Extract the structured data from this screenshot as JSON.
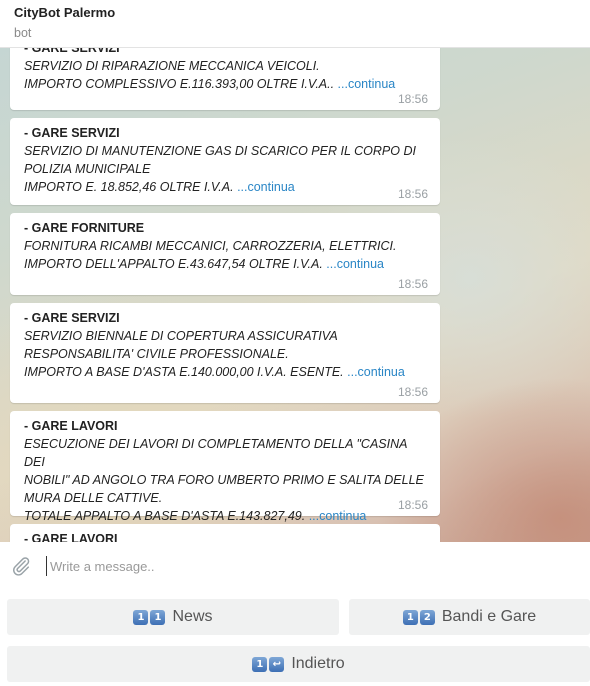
{
  "header": {
    "title": "CityBot Palermo",
    "subtitle": "bot"
  },
  "messages": [
    {
      "category": "- GARE SERVIZI",
      "lines": [
        "SERVIZIO DI RIPARAZIONE MECCANICA VEICOLI.",
        "IMPORTO COMPLESSIVO E.116.393,00 OLTRE I.V.A.. "
      ],
      "more": "...continua",
      "time": "18:56"
    },
    {
      "category": "- GARE SERVIZI",
      "lines": [
        "SERVIZIO DI MANUTENZIONE GAS DI SCARICO PER IL CORPO DI",
        "POLIZIA MUNICIPALE",
        "IMPORTO E. 18.852,46 OLTRE I.V.A. "
      ],
      "more": "...continua",
      "time": "18:56"
    },
    {
      "category": "- GARE FORNITURE",
      "lines": [
        "FORNITURA RICAMBI MECCANICI, CARROZZERIA, ELETTRICI.",
        "IMPORTO DELL'APPALTO E.43.647,54 OLTRE I.V.A. "
      ],
      "more": "...continua",
      "time": "18:56"
    },
    {
      "category": "- GARE SERVIZI",
      "lines": [
        "SERVIZIO BIENNALE DI COPERTURA ASSICURATIVA",
        "RESPONSABILITA' CIVILE PROFESSIONALE.",
        "IMPORTO A BASE D'ASTA E.140.000,00 I.V.A. ESENTE. "
      ],
      "more": "...continua",
      "time": "18:56"
    },
    {
      "category": "- GARE LAVORI",
      "lines": [
        "ESECUZIONE DEI LAVORI DI COMPLETAMENTO DELLA \"CASINA DEI",
        "NOBILI\" AD ANGOLO TRA FORO UMBERTO PRIMO E SALITA DELLE",
        "MURA DELLE CATTIVE.",
        "TOTALE APPALTO A BASE D'ASTA E.143.827,49. "
      ],
      "more": "...continua",
      "time": "18:56"
    },
    {
      "category": "- GARE LAVORI"
    }
  ],
  "composer": {
    "placeholder": "Write a message.."
  },
  "keyboard": {
    "news": {
      "keys": [
        "1",
        "1"
      ],
      "label": "News"
    },
    "bandi": {
      "keys": [
        "1",
        "2"
      ],
      "label": "Bandi e Gare"
    },
    "indietro": {
      "keys": [
        "1",
        "↩"
      ],
      "label": "Indietro"
    }
  },
  "icons": {
    "attach": "paperclip-icon"
  },
  "colors": {
    "link": "#2a86c6",
    "timestamp": "#9aa0a4",
    "keycap": "#3d6fb4"
  }
}
